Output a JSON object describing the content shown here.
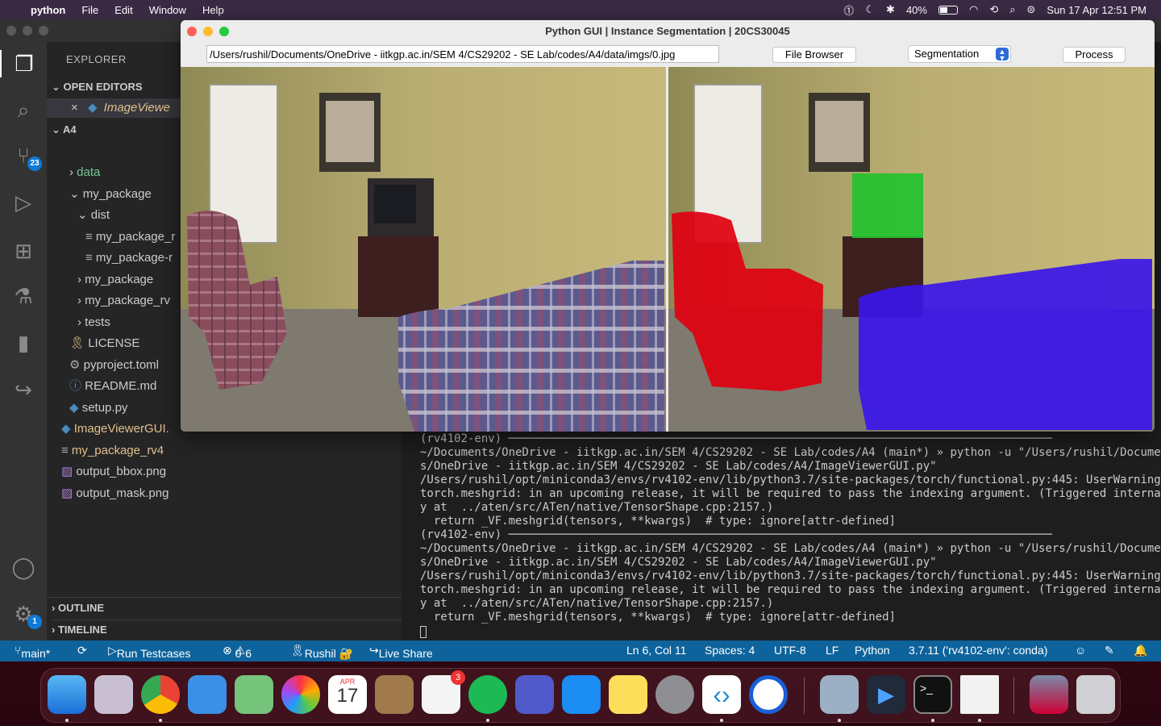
{
  "menubar": {
    "app": "python",
    "items": [
      "File",
      "Edit",
      "Window",
      "Help"
    ],
    "battery": "40%",
    "datetime": "Sun 17 Apr  12:51 PM"
  },
  "vscode": {
    "explorer_title": "EXPLORER",
    "open_editors": "OPEN EDITORS",
    "open_file": "ImageViewe",
    "root": "A4",
    "tree": [
      {
        "label": "data",
        "kind": "folder"
      },
      {
        "label": "my_package",
        "kind": "folder-open"
      },
      {
        "label": "dist",
        "kind": "folder-open"
      },
      {
        "label": "my_package_r",
        "kind": "file"
      },
      {
        "label": "my_package-r",
        "kind": "file"
      },
      {
        "label": "my_package",
        "kind": "folder"
      },
      {
        "label": "my_package_rv",
        "kind": "folder"
      },
      {
        "label": "tests",
        "kind": "folder"
      },
      {
        "label": "LICENSE",
        "kind": "license"
      },
      {
        "label": "pyproject.toml",
        "kind": "toml"
      },
      {
        "label": "README.md",
        "kind": "readme"
      },
      {
        "label": "setup.py",
        "kind": "python"
      },
      {
        "label": "ImageViewerGUI.",
        "kind": "python"
      },
      {
        "label": "my_package_rv4",
        "kind": "file"
      },
      {
        "label": "output_bbox.png",
        "kind": "image"
      },
      {
        "label": "output_mask.png",
        "kind": "image"
      }
    ],
    "outline": "OUTLINE",
    "timeline": "TIMELINE",
    "source_control_badge": "23",
    "settings_badge": "1",
    "terminal_lines": [
      "(rv4102-env) ────────────────────────────────────────────────────────────────────────────────",
      "~/Documents/OneDrive - iitkgp.ac.in/SEM 4/CS29202 - SE Lab/codes/A4 (main*) » python -u \"/Users/rushil/Document",
      "s/OneDrive - iitkgp.ac.in/SEM 4/CS29202 - SE Lab/codes/A4/ImageViewerGUI.py\"",
      "/Users/rushil/opt/miniconda3/envs/rv4102-env/lib/python3.7/site-packages/torch/functional.py:445: UserWarning:",
      "torch.meshgrid: in an upcoming release, it will be required to pass the indexing argument. (Triggered internall",
      "y at  ../aten/src/ATen/native/TensorShape.cpp:2157.)",
      "  return _VF.meshgrid(tensors, **kwargs)  # type: ignore[attr-defined]",
      "(rv4102-env) ────────────────────────────────────────────────────────────────────────────────",
      "~/Documents/OneDrive - iitkgp.ac.in/SEM 4/CS29202 - SE Lab/codes/A4 (main*) » python -u \"/Users/rushil/Document",
      "s/OneDrive - iitkgp.ac.in/SEM 4/CS29202 - SE Lab/codes/A4/ImageViewerGUI.py\"",
      "/Users/rushil/opt/miniconda3/envs/rv4102-env/lib/python3.7/site-packages/torch/functional.py:445: UserWarning:",
      "torch.meshgrid: in an upcoming release, it will be required to pass the indexing argument. (Triggered internall",
      "y at  ../aten/src/ATen/native/TensorShape.cpp:2157.)",
      "  return _VF.meshgrid(tensors, **kwargs)  # type: ignore[attr-defined]"
    ],
    "status": {
      "branch": "main*",
      "run": "Run Testcases",
      "errors": "0",
      "warnings": "6",
      "user": "Rushil 🔐",
      "liveshare": "Live Share",
      "position": "Ln 6, Col 11",
      "spaces": "Spaces: 4",
      "encoding": "UTF-8",
      "eol": "LF",
      "language": "Python",
      "interpreter": "3.7.11 ('rv4102-env': conda)"
    }
  },
  "gui": {
    "title": "Python GUI | Instance Segmentation | 20CS30045",
    "path": "/Users/rushil/Documents/OneDrive - iitkgp.ac.in/SEM 4/CS29202 - SE Lab/codes/A4/data/imgs/0.jpg",
    "browse_label": "File Browser",
    "mode_value": "Segmentation",
    "process_label": "Process"
  },
  "dock": {
    "calendar_month": "APR",
    "calendar_day": "17",
    "reminders_badge": "3"
  }
}
